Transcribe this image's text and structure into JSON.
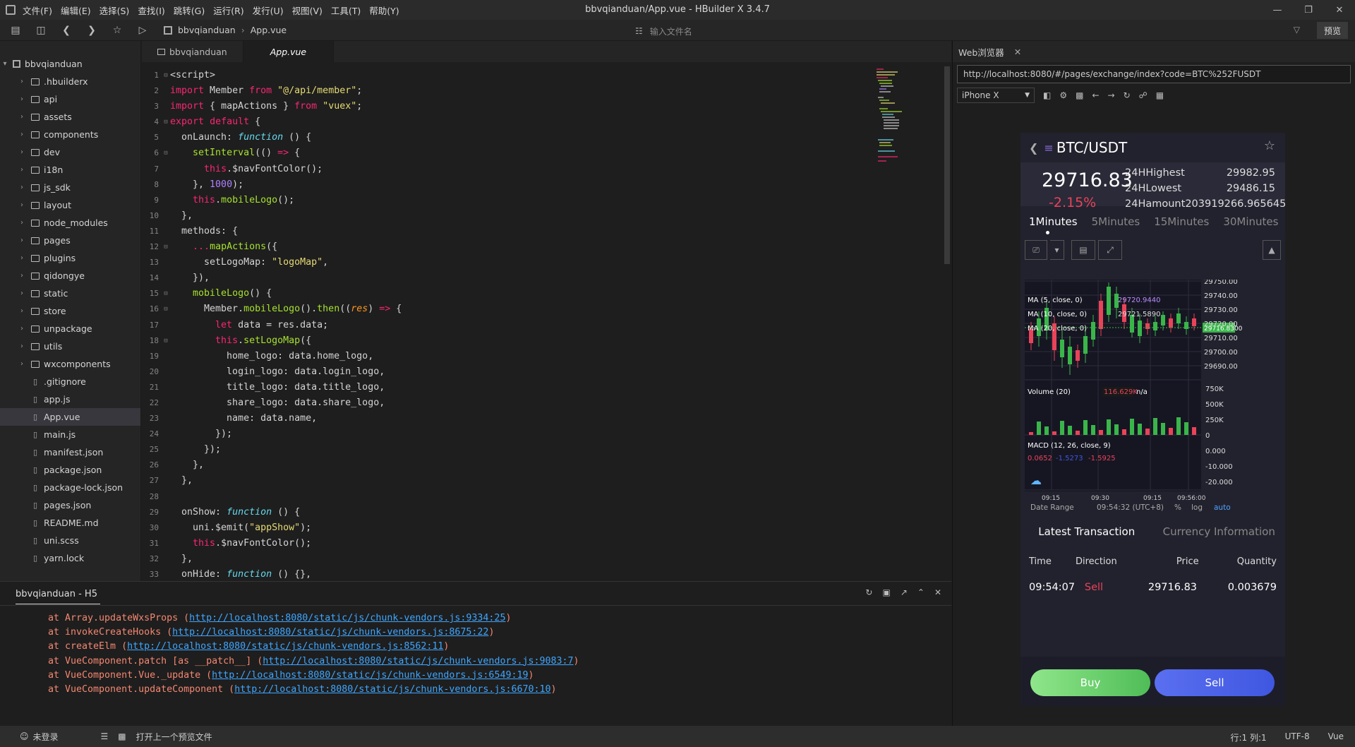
{
  "app": {
    "title": "bbvqianduan/App.vue - HBuilder X 3.4.7",
    "menu": [
      "文件(F)",
      "编辑(E)",
      "选择(S)",
      "查找(I)",
      "跳转(G)",
      "运行(R)",
      "发行(U)",
      "视图(V)",
      "工具(T)",
      "帮助(Y)"
    ],
    "window_controls": [
      "—",
      "❐",
      "✕"
    ]
  },
  "toolbar": {
    "breadcrumb": [
      "bbvqianduan",
      "App.vue"
    ],
    "search_placeholder": "输入文件名",
    "preview_label": "预览"
  },
  "sidebar": {
    "root": "bbvqianduan",
    "items": [
      {
        "label": ".hbuilderx",
        "type": "folder"
      },
      {
        "label": "api",
        "type": "folder"
      },
      {
        "label": "assets",
        "type": "folder"
      },
      {
        "label": "components",
        "type": "folder"
      },
      {
        "label": "dev",
        "type": "folder"
      },
      {
        "label": "i18n",
        "type": "folder"
      },
      {
        "label": "js_sdk",
        "type": "folder"
      },
      {
        "label": "layout",
        "type": "folder"
      },
      {
        "label": "node_modules",
        "type": "folder"
      },
      {
        "label": "pages",
        "type": "folder"
      },
      {
        "label": "plugins",
        "type": "folder"
      },
      {
        "label": "qidongye",
        "type": "folder"
      },
      {
        "label": "static",
        "type": "folder"
      },
      {
        "label": "store",
        "type": "folder"
      },
      {
        "label": "unpackage",
        "type": "folder"
      },
      {
        "label": "utils",
        "type": "folder"
      },
      {
        "label": "wxcomponents",
        "type": "folder"
      },
      {
        "label": ".gitignore",
        "type": "file"
      },
      {
        "label": "app.js",
        "type": "file"
      },
      {
        "label": "App.vue",
        "type": "file",
        "selected": true
      },
      {
        "label": "main.js",
        "type": "file"
      },
      {
        "label": "manifest.json",
        "type": "file"
      },
      {
        "label": "package.json",
        "type": "file"
      },
      {
        "label": "package-lock.json",
        "type": "file"
      },
      {
        "label": "pages.json",
        "type": "file"
      },
      {
        "label": "README.md",
        "type": "file"
      },
      {
        "label": "uni.scss",
        "type": "file"
      },
      {
        "label": "yarn.lock",
        "type": "file"
      }
    ]
  },
  "editor": {
    "tabs": [
      "bbvqianduan",
      "App.vue"
    ],
    "lines": [
      "<script>",
      "import Member from \"@/api/member\";",
      "import { mapActions } from \"vuex\";",
      "export default {",
      "  onLaunch: function () {",
      "    setInterval(() => {",
      "      this.$navFontColor();",
      "    }, 1000);",
      "    this.mobileLogo();",
      "  },",
      "  methods: {",
      "    ...mapActions({",
      "      setLogoMap: \"logoMap\",",
      "    }),",
      "    mobileLogo() {",
      "      Member.mobileLogo().then((res) => {",
      "        let data = res.data;",
      "        this.setLogoMap({",
      "          home_logo: data.home_logo,",
      "          login_logo: data.login_logo,",
      "          title_logo: data.title_logo,",
      "          share_logo: data.share_logo,",
      "          name: data.name,",
      "        });",
      "      });",
      "    },",
      "  },",
      "",
      "  onShow: function () {",
      "    uni.$emit(\"appShow\");",
      "    this.$navFontColor();",
      "  },",
      "  onHide: function () {},"
    ]
  },
  "console": {
    "title": "bbvqianduan - H5",
    "errors": [
      {
        "prefix": "at Array.updateWxsProps (",
        "link": "http://localhost:8080/static/js/chunk-vendors.js:9334:25",
        "suffix": ")"
      },
      {
        "prefix": "at invokeCreateHooks (",
        "link": "http://localhost:8080/static/js/chunk-vendors.js:8675:22",
        "suffix": ")"
      },
      {
        "prefix": "at createElm (",
        "link": "http://localhost:8080/static/js/chunk-vendors.js:8562:11",
        "suffix": ")"
      },
      {
        "prefix": "at VueComponent.patch [as __patch__] (",
        "link": "http://localhost:8080/static/js/chunk-vendors.js:9083:7",
        "suffix": ")"
      },
      {
        "prefix": "at VueComponent.Vue._update (",
        "link": "http://localhost:8080/static/js/chunk-vendors.js:6549:19",
        "suffix": ")"
      },
      {
        "prefix": "at VueComponent.updateComponent (",
        "link": "http://localhost:8080/static/js/chunk-vendors.js:6670:10",
        "suffix": ")"
      }
    ]
  },
  "statusbar": {
    "login": "未登录",
    "preview_hint": "打开上一个预览文件",
    "position": "行:1   列:1",
    "encoding": "UTF-8",
    "language": "Vue"
  },
  "browser": {
    "tab": "Web浏览器",
    "url": "http://localhost:8080/#/pages/exchange/index?code=BTC%252FUSDT",
    "device": "iPhone X"
  },
  "phone": {
    "pair": "BTC/USDT",
    "price": "29716.83",
    "change": "-2.15%",
    "stats": [
      {
        "label": "24HHighest",
        "value": "29982.95"
      },
      {
        "label": "24HLowest",
        "value": "29486.15"
      },
      {
        "label": "24Hamount",
        "value": "203919266.9656451"
      }
    ],
    "intervals": [
      "1Minutes",
      "5Minutes",
      "15Minutes",
      "30Minutes"
    ],
    "chart": {
      "ma5": "MA (5, close, 0)",
      "ma5_val": "29720.9440",
      "ma10": "MA (10, close, 0)",
      "ma10_val": "29721.5890",
      "ma20": "MA (20, close, 0)",
      "price_ticks": [
        "29750.00",
        "29740.00",
        "29730.00",
        "29720.00",
        "29710.00",
        "29700.00",
        "29690.00"
      ],
      "current_price_tag": "29716.8300",
      "volume_label": "Volume (20)",
      "volume_val": "116.629K",
      "volume_na": "n/a",
      "volume_ticks": [
        "750K",
        "500K",
        "250K",
        "0"
      ],
      "macd_label": "MACD (12, 26, close, 9)",
      "macd_vals": [
        "0.0652",
        "-1.5273",
        "-1.5925"
      ],
      "macd_ticks": [
        "0.000",
        "-10.000",
        "-20.000"
      ],
      "time_ticks": [
        "09:15",
        "09:30",
        "09:15",
        "09:56:00"
      ],
      "date_range": "Date Range",
      "clock": "09:54:32 (UTC+8)",
      "scale_opts": [
        "%",
        "log",
        "auto"
      ]
    },
    "txn_tabs": [
      "Latest Transaction",
      "Currency Information"
    ],
    "txn_headers": [
      "Time",
      "Direction",
      "Price",
      "Quantity"
    ],
    "txn_row": [
      "09:54:07",
      "Sell",
      "29716.83",
      "0.003679"
    ],
    "buy": "Buy",
    "sell": "Sell"
  }
}
